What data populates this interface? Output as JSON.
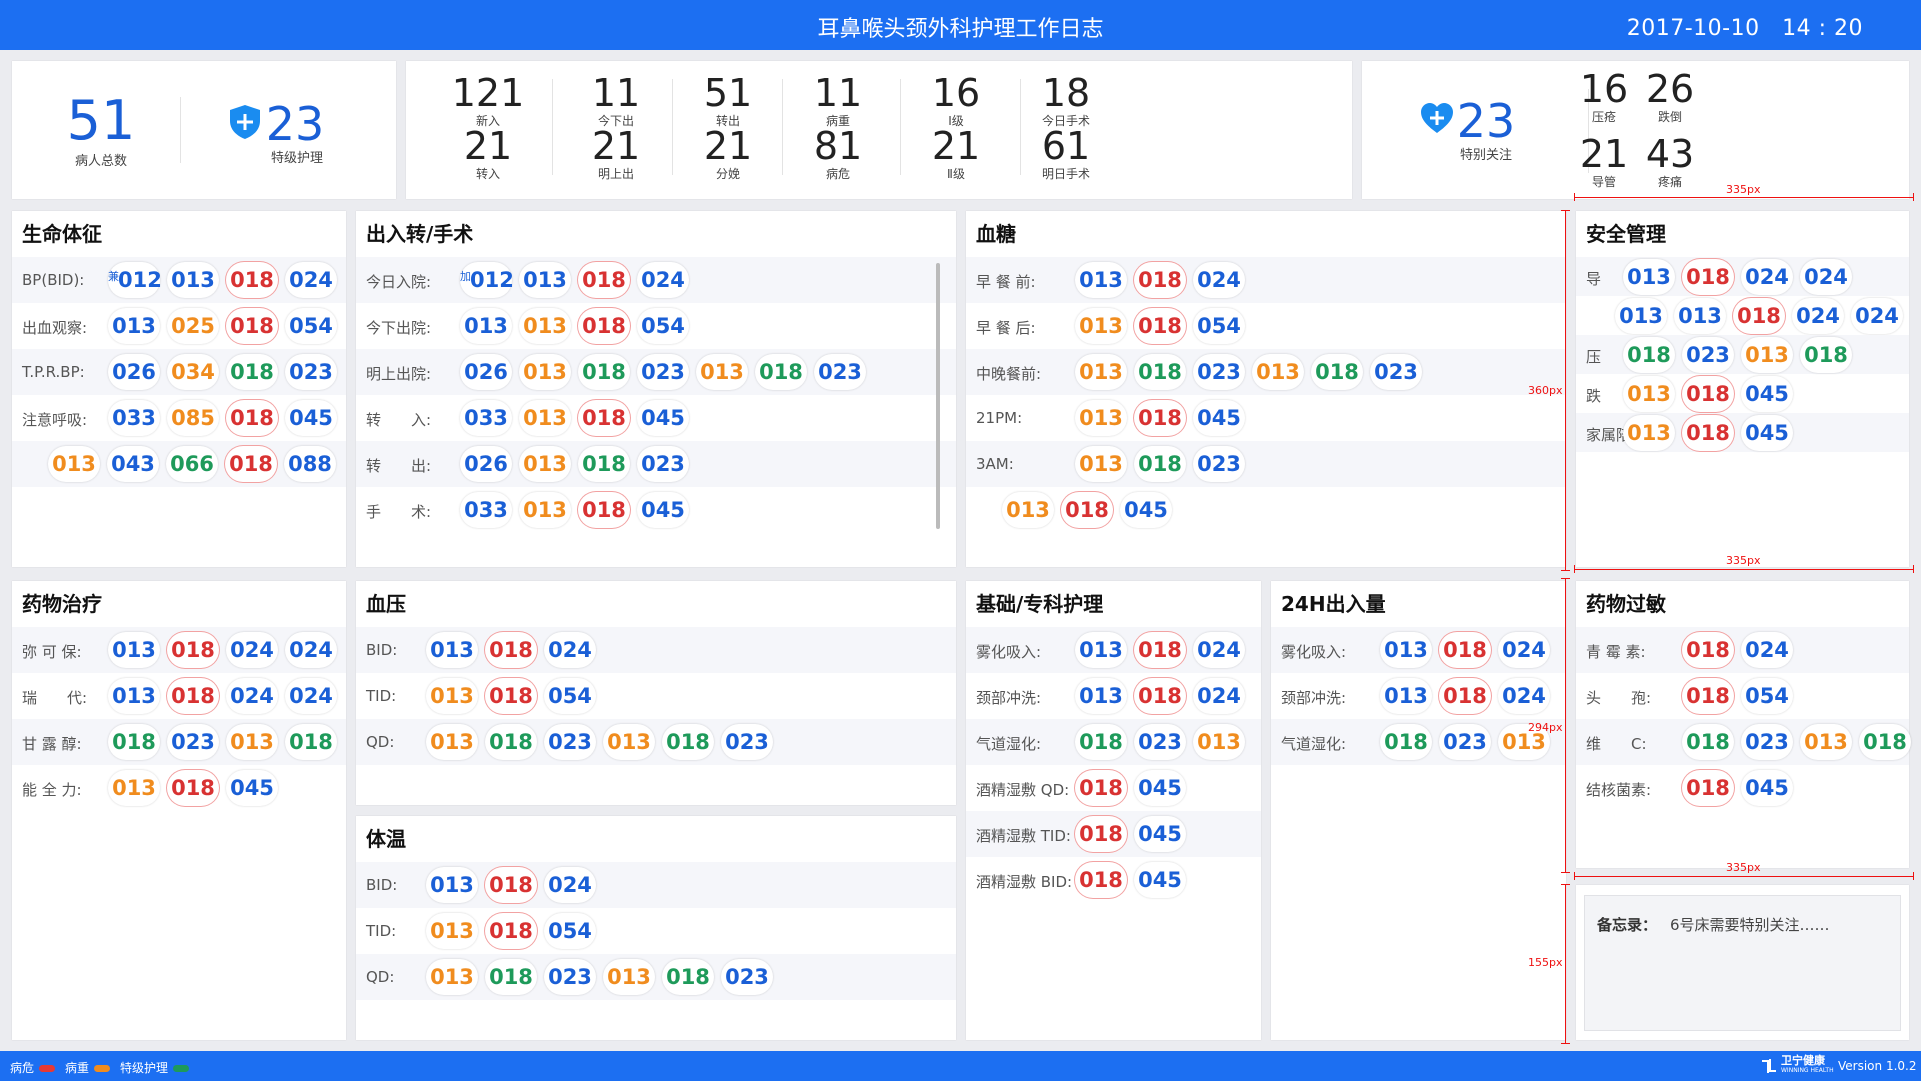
{
  "header": {
    "title": "耳鼻喉头颈外科护理工作日志",
    "datetime": "2017-10-10　14 : 20"
  },
  "summary": {
    "total": {
      "value": "51",
      "label": "病人总数"
    },
    "special_care": {
      "value": "23",
      "label": "特级护理"
    },
    "stats": [
      {
        "value": "121",
        "label": "新入"
      },
      {
        "value": "11",
        "label": "今下出"
      },
      {
        "value": "51",
        "label": "转出"
      },
      {
        "value": "11",
        "label": "病重"
      },
      {
        "value": "16",
        "label": "Ⅰ级"
      },
      {
        "value": "18",
        "label": "今日手术"
      },
      {
        "value": "21",
        "label": "转入"
      },
      {
        "value": "21",
        "label": "明上出"
      },
      {
        "value": "21",
        "label": "分娩"
      },
      {
        "value": "81",
        "label": "病危"
      },
      {
        "value": "21",
        "label": "Ⅱ级"
      },
      {
        "value": "61",
        "label": "明日手术"
      }
    ],
    "attention": {
      "value": "23",
      "label": "特别关注"
    },
    "risks": [
      {
        "value": "16",
        "label": "压疮"
      },
      {
        "value": "26",
        "label": "跌倒"
      },
      {
        "value": "21",
        "label": "导管"
      },
      {
        "value": "43",
        "label": "疼痛"
      }
    ]
  },
  "panels": {
    "vitals": {
      "title": "生命体征",
      "rows": [
        {
          "label": "BP(BID):",
          "beds": [
            {
              "n": "012",
              "c": "blue",
              "tag": "兼"
            },
            {
              "n": "013",
              "c": "blue"
            },
            {
              "n": "018",
              "c": "red"
            },
            {
              "n": "024",
              "c": "blue"
            }
          ]
        },
        {
          "label": "出血观察:",
          "beds": [
            {
              "n": "013",
              "c": "blue"
            },
            {
              "n": "025",
              "c": "orange"
            },
            {
              "n": "018",
              "c": "red"
            },
            {
              "n": "054",
              "c": "blue"
            }
          ]
        },
        {
          "label": "T.P.R.BP:",
          "beds": [
            {
              "n": "026",
              "c": "blue"
            },
            {
              "n": "034",
              "c": "orange"
            },
            {
              "n": "018",
              "c": "green"
            },
            {
              "n": "023",
              "c": "blue"
            }
          ]
        },
        {
          "label": "注意呼吸:",
          "beds": [
            {
              "n": "033",
              "c": "blue"
            },
            {
              "n": "085",
              "c": "orange"
            },
            {
              "n": "018",
              "c": "red"
            },
            {
              "n": "045",
              "c": "blue"
            }
          ]
        },
        {
          "label": "",
          "beds": [
            {
              "n": "013",
              "c": "orange"
            },
            {
              "n": "043",
              "c": "blue"
            },
            {
              "n": "066",
              "c": "green"
            },
            {
              "n": "018",
              "c": "red"
            },
            {
              "n": "088",
              "c": "blue"
            }
          ]
        }
      ]
    },
    "transfer": {
      "title": "出入转/手术",
      "rows": [
        {
          "label": "今日入院:",
          "beds": [
            {
              "n": "012",
              "c": "blue",
              "tag": "加"
            },
            {
              "n": "013",
              "c": "blue"
            },
            {
              "n": "018",
              "c": "red"
            },
            {
              "n": "024",
              "c": "blue"
            }
          ]
        },
        {
          "label": "今下出院:",
          "beds": [
            {
              "n": "013",
              "c": "blue"
            },
            {
              "n": "013",
              "c": "orange"
            },
            {
              "n": "018",
              "c": "red"
            },
            {
              "n": "054",
              "c": "blue"
            }
          ]
        },
        {
          "label": "明上出院:",
          "beds": [
            {
              "n": "026",
              "c": "blue"
            },
            {
              "n": "013",
              "c": "orange"
            },
            {
              "n": "018",
              "c": "green"
            },
            {
              "n": "023",
              "c": "blue"
            },
            {
              "n": "013",
              "c": "orange"
            },
            {
              "n": "018",
              "c": "green"
            },
            {
              "n": "023",
              "c": "blue"
            }
          ]
        },
        {
          "label": "转　　入:",
          "beds": [
            {
              "n": "033",
              "c": "blue"
            },
            {
              "n": "013",
              "c": "orange"
            },
            {
              "n": "018",
              "c": "red"
            },
            {
              "n": "045",
              "c": "blue"
            }
          ]
        },
        {
          "label": "转　　出:",
          "beds": [
            {
              "n": "026",
              "c": "blue"
            },
            {
              "n": "013",
              "c": "orange"
            },
            {
              "n": "018",
              "c": "green"
            },
            {
              "n": "023",
              "c": "blue"
            }
          ]
        },
        {
          "label": "手　　术:",
          "beds": [
            {
              "n": "033",
              "c": "blue"
            },
            {
              "n": "013",
              "c": "orange"
            },
            {
              "n": "018",
              "c": "red"
            },
            {
              "n": "045",
              "c": "blue"
            }
          ]
        }
      ]
    },
    "glucose": {
      "title": "血糖",
      "rows": [
        {
          "label": "早 餐 前:",
          "beds": [
            {
              "n": "013",
              "c": "blue"
            },
            {
              "n": "018",
              "c": "red"
            },
            {
              "n": "024",
              "c": "blue"
            }
          ]
        },
        {
          "label": "早 餐 后:",
          "beds": [
            {
              "n": "013",
              "c": "orange"
            },
            {
              "n": "018",
              "c": "red"
            },
            {
              "n": "054",
              "c": "blue"
            }
          ]
        },
        {
          "label": "中晚餐前:",
          "beds": [
            {
              "n": "013",
              "c": "orange"
            },
            {
              "n": "018",
              "c": "green"
            },
            {
              "n": "023",
              "c": "blue"
            },
            {
              "n": "013",
              "c": "orange"
            },
            {
              "n": "018",
              "c": "green"
            },
            {
              "n": "023",
              "c": "blue"
            }
          ]
        },
        {
          "label": "21PM:",
          "beds": [
            {
              "n": "013",
              "c": "orange"
            },
            {
              "n": "018",
              "c": "red"
            },
            {
              "n": "045",
              "c": "blue"
            }
          ]
        },
        {
          "label": "3AM:",
          "beds": [
            {
              "n": "013",
              "c": "orange"
            },
            {
              "n": "018",
              "c": "green"
            },
            {
              "n": "023",
              "c": "blue"
            }
          ]
        },
        {
          "label": "",
          "beds": [
            {
              "n": "013",
              "c": "orange"
            },
            {
              "n": "018",
              "c": "red"
            },
            {
              "n": "045",
              "c": "blue"
            }
          ]
        }
      ]
    },
    "safety": {
      "title": "安全管理",
      "rows": [
        {
          "label": "导　　管:",
          "beds": [
            {
              "n": "013",
              "c": "blue"
            },
            {
              "n": "018",
              "c": "red"
            },
            {
              "n": "024",
              "c": "blue"
            },
            {
              "n": "024",
              "c": "blue"
            }
          ]
        },
        {
          "label": "",
          "beds": [
            {
              "n": "013",
              "c": "blue"
            },
            {
              "n": "013",
              "c": "blue"
            },
            {
              "n": "018",
              "c": "red"
            },
            {
              "n": "024",
              "c": "blue"
            },
            {
              "n": "024",
              "c": "blue"
            }
          ]
        },
        {
          "label": "压　　疮:",
          "beds": [
            {
              "n": "018",
              "c": "green"
            },
            {
              "n": "023",
              "c": "blue"
            },
            {
              "n": "013",
              "c": "orange"
            },
            {
              "n": "018",
              "c": "green"
            }
          ]
        },
        {
          "label": "跌　　倒:",
          "beds": [
            {
              "n": "013",
              "c": "orange"
            },
            {
              "n": "018",
              "c": "red"
            },
            {
              "n": "045",
              "c": "blue"
            }
          ]
        },
        {
          "label": "家属陪护:",
          "beds": [
            {
              "n": "013",
              "c": "orange"
            },
            {
              "n": "018",
              "c": "red"
            },
            {
              "n": "045",
              "c": "blue"
            }
          ]
        }
      ]
    },
    "medication": {
      "title": "药物治疗",
      "rows": [
        {
          "label": "弥 可 保:",
          "beds": [
            {
              "n": "013",
              "c": "blue"
            },
            {
              "n": "018",
              "c": "red"
            },
            {
              "n": "024",
              "c": "blue"
            },
            {
              "n": "024",
              "c": "blue"
            }
          ]
        },
        {
          "label": "瑞　　代:",
          "beds": [
            {
              "n": "013",
              "c": "blue"
            },
            {
              "n": "018",
              "c": "red"
            },
            {
              "n": "024",
              "c": "blue"
            },
            {
              "n": "024",
              "c": "blue"
            }
          ]
        },
        {
          "label": "甘 露 醇:",
          "beds": [
            {
              "n": "018",
              "c": "green"
            },
            {
              "n": "023",
              "c": "blue"
            },
            {
              "n": "013",
              "c": "orange"
            },
            {
              "n": "018",
              "c": "green"
            }
          ]
        },
        {
          "label": "能 全 力:",
          "beds": [
            {
              "n": "013",
              "c": "orange"
            },
            {
              "n": "018",
              "c": "red"
            },
            {
              "n": "045",
              "c": "blue"
            }
          ]
        }
      ]
    },
    "bp": {
      "title": "血压",
      "rows": [
        {
          "label": "BID:",
          "beds": [
            {
              "n": "013",
              "c": "blue"
            },
            {
              "n": "018",
              "c": "red"
            },
            {
              "n": "024",
              "c": "blue"
            }
          ]
        },
        {
          "label": "TID:",
          "beds": [
            {
              "n": "013",
              "c": "orange"
            },
            {
              "n": "018",
              "c": "red"
            },
            {
              "n": "054",
              "c": "blue"
            }
          ]
        },
        {
          "label": "QD:",
          "beds": [
            {
              "n": "013",
              "c": "orange"
            },
            {
              "n": "018",
              "c": "green"
            },
            {
              "n": "023",
              "c": "blue"
            },
            {
              "n": "013",
              "c": "orange"
            },
            {
              "n": "018",
              "c": "green"
            },
            {
              "n": "023",
              "c": "blue"
            }
          ]
        }
      ]
    },
    "temp": {
      "title": "体温",
      "rows": [
        {
          "label": "BID:",
          "beds": [
            {
              "n": "013",
              "c": "blue"
            },
            {
              "n": "018",
              "c": "red"
            },
            {
              "n": "024",
              "c": "blue"
            }
          ]
        },
        {
          "label": "TID:",
          "beds": [
            {
              "n": "013",
              "c": "orange"
            },
            {
              "n": "018",
              "c": "red"
            },
            {
              "n": "054",
              "c": "blue"
            }
          ]
        },
        {
          "label": "QD:",
          "beds": [
            {
              "n": "013",
              "c": "orange"
            },
            {
              "n": "018",
              "c": "green"
            },
            {
              "n": "023",
              "c": "blue"
            },
            {
              "n": "013",
              "c": "orange"
            },
            {
              "n": "018",
              "c": "green"
            },
            {
              "n": "023",
              "c": "blue"
            }
          ]
        }
      ]
    },
    "basic": {
      "title": "基础/专科护理",
      "rows": [
        {
          "label": "雾化吸入:",
          "beds": [
            {
              "n": "013",
              "c": "blue"
            },
            {
              "n": "018",
              "c": "red"
            },
            {
              "n": "024",
              "c": "blue"
            }
          ]
        },
        {
          "label": "颈部冲洗:",
          "beds": [
            {
              "n": "013",
              "c": "blue"
            },
            {
              "n": "018",
              "c": "red"
            },
            {
              "n": "024",
              "c": "blue"
            }
          ]
        },
        {
          "label": "气道湿化:",
          "beds": [
            {
              "n": "018",
              "c": "green"
            },
            {
              "n": "023",
              "c": "blue"
            },
            {
              "n": "013",
              "c": "orange"
            }
          ]
        },
        {
          "label": "酒精湿敷 QD:",
          "beds": [
            {
              "n": "018",
              "c": "red"
            },
            {
              "n": "045",
              "c": "blue"
            }
          ]
        },
        {
          "label": "酒精湿敷 TID:",
          "beds": [
            {
              "n": "018",
              "c": "red"
            },
            {
              "n": "045",
              "c": "blue"
            }
          ]
        },
        {
          "label": "酒精湿敷 BID:",
          "beds": [
            {
              "n": "018",
              "c": "red"
            },
            {
              "n": "045",
              "c": "blue"
            }
          ]
        }
      ]
    },
    "io24": {
      "title": "24H出入量",
      "rows": [
        {
          "label": "雾化吸入:",
          "beds": [
            {
              "n": "013",
              "c": "blue"
            },
            {
              "n": "018",
              "c": "red"
            },
            {
              "n": "024",
              "c": "blue"
            }
          ]
        },
        {
          "label": "颈部冲洗:",
          "beds": [
            {
              "n": "013",
              "c": "blue"
            },
            {
              "n": "018",
              "c": "red"
            },
            {
              "n": "024",
              "c": "blue"
            }
          ]
        },
        {
          "label": "气道湿化:",
          "beds": [
            {
              "n": "018",
              "c": "green"
            },
            {
              "n": "023",
              "c": "blue"
            },
            {
              "n": "013",
              "c": "orange"
            }
          ]
        }
      ]
    },
    "allergy": {
      "title": "药物过敏",
      "rows": [
        {
          "label": "青 霉 素:",
          "beds": [
            {
              "n": "018",
              "c": "red"
            },
            {
              "n": "024",
              "c": "blue"
            }
          ]
        },
        {
          "label": "头　　孢:",
          "beds": [
            {
              "n": "018",
              "c": "red"
            },
            {
              "n": "054",
              "c": "blue"
            }
          ]
        },
        {
          "label": "维　　C:",
          "beds": [
            {
              "n": "018",
              "c": "green"
            },
            {
              "n": "023",
              "c": "blue"
            },
            {
              "n": "013",
              "c": "orange"
            },
            {
              "n": "018",
              "c": "green"
            }
          ]
        },
        {
          "label": "结核菌素:",
          "beds": [
            {
              "n": "018",
              "c": "red"
            },
            {
              "n": "045",
              "c": "blue"
            }
          ]
        }
      ]
    }
  },
  "memo": {
    "label": "备忘录：",
    "text": "6号床需要特别关注……"
  },
  "dimension_annotations": [
    "335px",
    "360px",
    "335px",
    "294px",
    "335px",
    "155px"
  ],
  "footer": {
    "legend": [
      {
        "label": "病危",
        "color": "#e53935"
      },
      {
        "label": "病重",
        "color": "#f08c1e"
      },
      {
        "label": "特级护理",
        "color": "#1e9a5a"
      }
    ],
    "brand": "卫宁健康",
    "brand_sub": "WINNING HEALTH",
    "version": "Version 1.0.2"
  },
  "colors": {
    "primary": "#1c6ff2",
    "blue": "#1a5fd6",
    "orange": "#f08c1e",
    "red": "#d83232",
    "green": "#1e9a5a"
  }
}
